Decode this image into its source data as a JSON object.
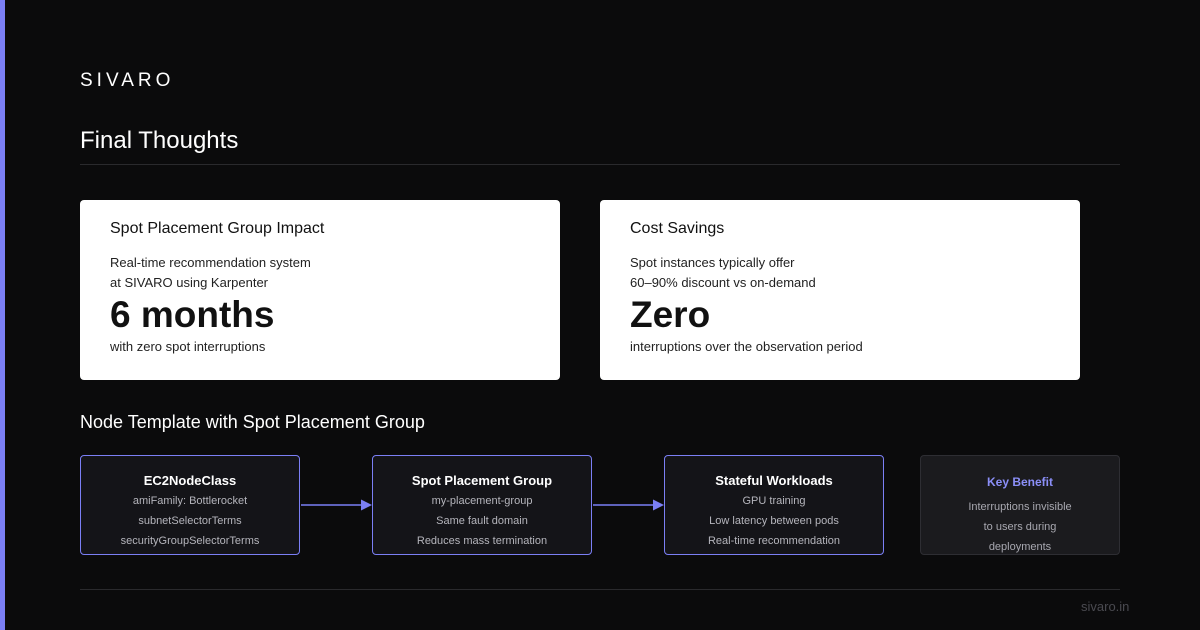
{
  "brand": {
    "logo": "SIVARO",
    "accent_color": "#7b7ff5"
  },
  "page": {
    "title": "Final Thoughts"
  },
  "cards": [
    {
      "title": "Spot Placement Group Impact",
      "lines": [
        "Real-time recommendation system",
        "at SIVARO using Karpenter"
      ],
      "big": "6 months",
      "foot": "with zero spot interruptions"
    },
    {
      "title": "Cost Savings",
      "lines": [
        "Spot instances typically offer",
        "60–90% discount vs on-demand"
      ],
      "big": "Zero",
      "foot": "interruptions over the observation period"
    }
  ],
  "diagram": {
    "title": "Node Template with Spot Placement Group",
    "nodes": [
      {
        "title": "EC2NodeClass",
        "lines": [
          "amiFamily: Bottlerocket",
          "subnetSelectorTerms",
          "securityGroupSelectorTerms"
        ]
      },
      {
        "title": "Spot Placement Group",
        "lines": [
          "my-placement-group",
          "Same fault domain",
          "Reduces mass termination"
        ]
      },
      {
        "title": "Stateful Workloads",
        "lines": [
          "GPU training",
          "Low latency between pods",
          "Real-time recommendation"
        ]
      }
    ],
    "benefit": {
      "title": "Key Benefit",
      "lines": [
        "Interruptions invisible",
        "to users during",
        "deployments"
      ],
      "title_color": "#8b8ff8"
    }
  },
  "footer": {
    "url": "sivaro.in"
  }
}
